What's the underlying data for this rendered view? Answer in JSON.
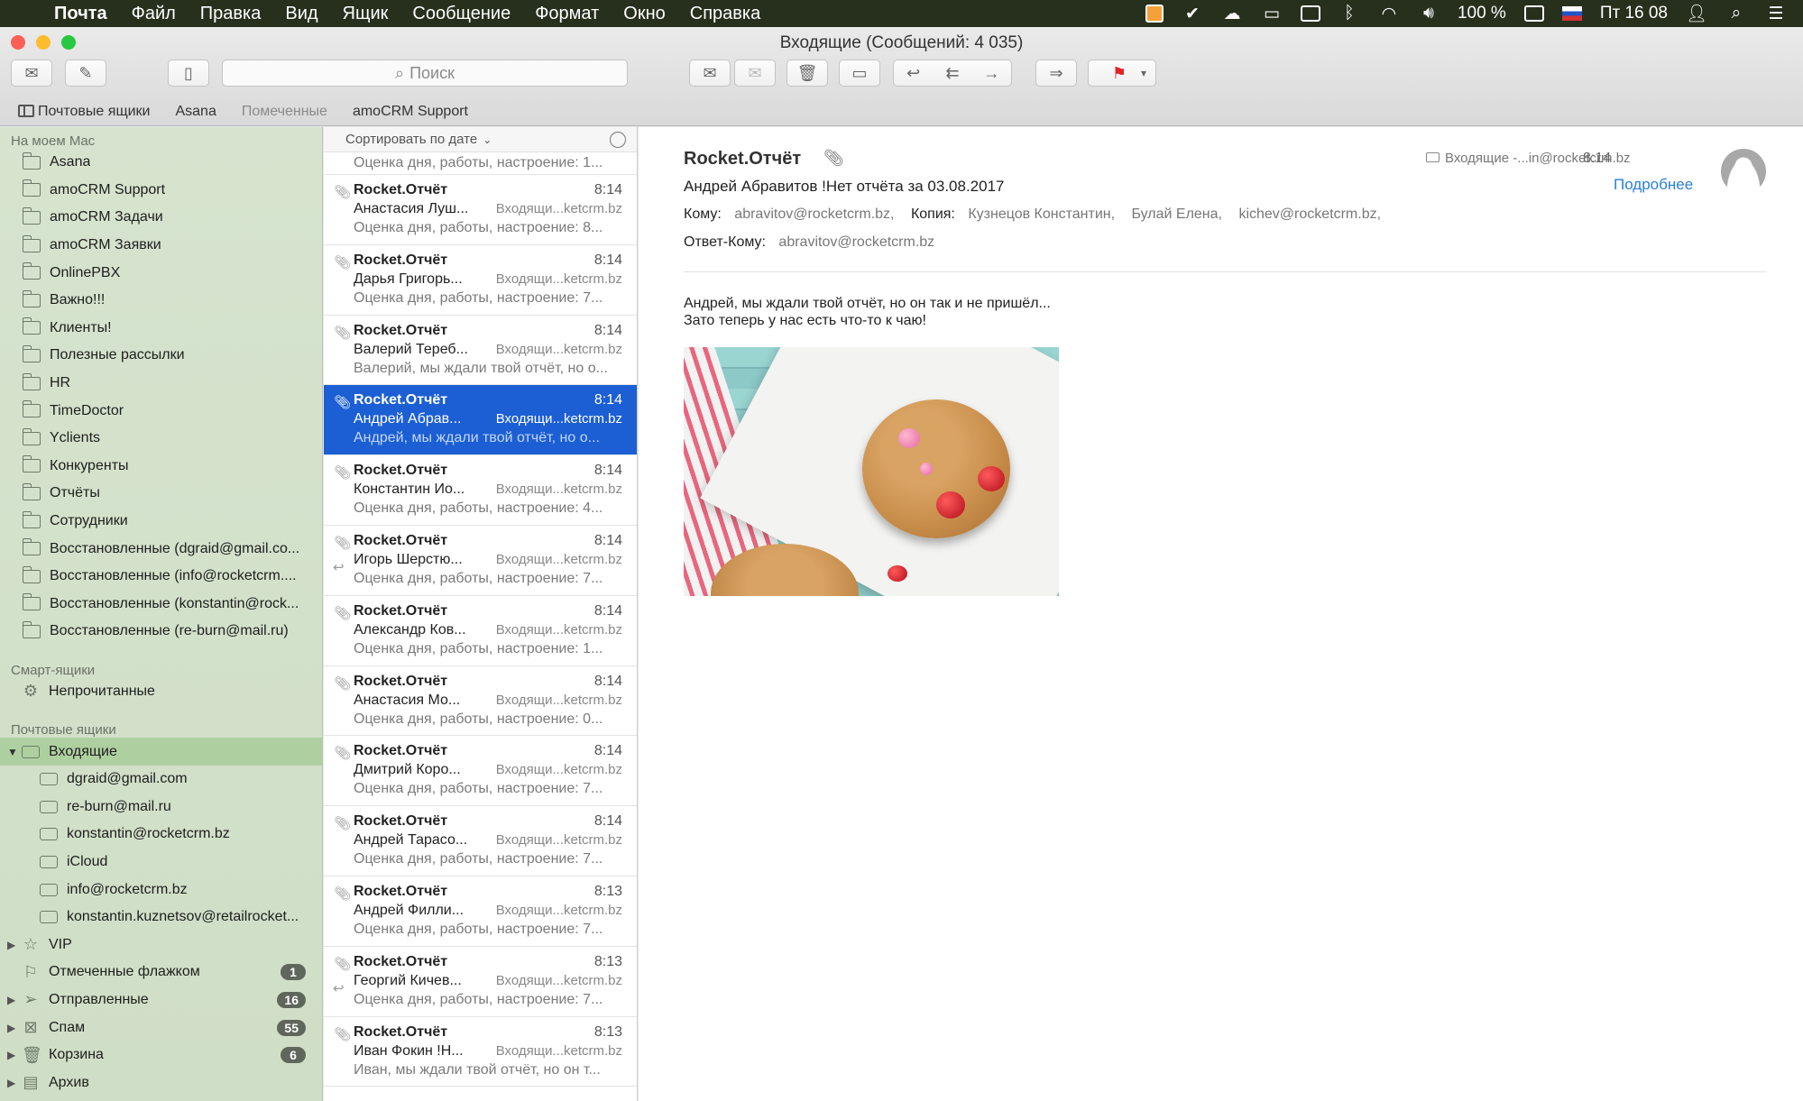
{
  "menubar": {
    "app": "Почта",
    "items": [
      "Файл",
      "Правка",
      "Вид",
      "Ящик",
      "Сообщение",
      "Формат",
      "Окно",
      "Справка"
    ],
    "battery": "100 %",
    "clock": "Пт 16 08"
  },
  "window": {
    "title": "Входящие (Сообщений: 4 035)"
  },
  "toolbar": {
    "search_placeholder": "Поиск"
  },
  "favorites": {
    "mailboxes": "Почтовые ящики",
    "items": [
      "Asana",
      "Помеченные",
      "amoCRM Support"
    ]
  },
  "sidebar": {
    "on_mac_title": "На моем Mac",
    "on_mac": [
      "Asana",
      "amoCRM Support",
      "amoCRM Задачи",
      "amoCRM Заявки",
      "OnlinePBX",
      "Важно!!!",
      "Клиенты!",
      "Полезные рассылки",
      "HR",
      "TimeDoctor",
      "Yclients",
      "Конкуренты",
      "Отчёты",
      "Сотрудники",
      "Восстановленные (dgraid@gmail.co...",
      "Восстановленные (info@rocketcrm....",
      "Восстановленные (konstantin@rock...",
      "Восстановленные (re-burn@mail.ru)"
    ],
    "smart_title": "Смарт-ящики",
    "smart": [
      "Непрочитанные"
    ],
    "mailboxes_title": "Почтовые ящики",
    "inbox": "Входящие",
    "accounts": [
      "dgraid@gmail.com",
      "re-burn@mail.ru",
      "konstantin@rocketcrm.bz",
      "iCloud",
      "info@rocketcrm.bz",
      "konstantin.kuznetsov@retailrocket..."
    ],
    "vip": "VIP",
    "flagged": {
      "label": "Отмеченные флажком",
      "count": "1"
    },
    "sent": {
      "label": "Отправленные",
      "count": "16"
    },
    "spam": {
      "label": "Спам",
      "count": "55"
    },
    "trash": {
      "label": "Корзина",
      "count": "6"
    },
    "archive": "Архив"
  },
  "list": {
    "sort_label": "Сортировать по дате",
    "cut_preview": "Оценка дня, работы, настроение: 1...",
    "messages": [
      {
        "subject": "Rocket.Отчёт",
        "time": "8:14",
        "from": "Анастасия Луш...",
        "box": "Входящи...ketcrm.bz",
        "preview": "Оценка дня, работы, настроение: 8..."
      },
      {
        "subject": "Rocket.Отчёт",
        "time": "8:14",
        "from": "Дарья Григорь...",
        "box": "Входящи...ketcrm.bz",
        "preview": "Оценка дня, работы, настроение: 7..."
      },
      {
        "subject": "Rocket.Отчёт",
        "time": "8:14",
        "from": "Валерий Тереб...",
        "box": "Входящи...ketcrm.bz",
        "preview": "Валерий, мы ждали твой отчёт, но о..."
      },
      {
        "subject": "Rocket.Отчёт",
        "time": "8:14",
        "from": "Андрей Абрав...",
        "box": "Входящи...ketcrm.bz",
        "preview": "Андрей, мы ждали твой отчёт, но о..."
      },
      {
        "subject": "Rocket.Отчёт",
        "time": "8:14",
        "from": "Константин Ио...",
        "box": "Входящи...ketcrm.bz",
        "preview": "Оценка дня, работы, настроение: 4..."
      },
      {
        "subject": "Rocket.Отчёт",
        "time": "8:14",
        "from": "Игорь Шерстю...",
        "box": "Входящи...ketcrm.bz",
        "preview": "Оценка дня, работы, настроение: 7..."
      },
      {
        "subject": "Rocket.Отчёт",
        "time": "8:14",
        "from": "Александр Ков...",
        "box": "Входящи...ketcrm.bz",
        "preview": "Оценка дня, работы, настроение: 1..."
      },
      {
        "subject": "Rocket.Отчёт",
        "time": "8:14",
        "from": "Анастасия Мо...",
        "box": "Входящи...ketcrm.bz",
        "preview": "Оценка дня, работы, настроение: 0..."
      },
      {
        "subject": "Rocket.Отчёт",
        "time": "8:14",
        "from": "Дмитрий Коро...",
        "box": "Входящи...ketcrm.bz",
        "preview": "Оценка дня, работы, настроение: 7..."
      },
      {
        "subject": "Rocket.Отчёт",
        "time": "8:14",
        "from": "Андрей Тарасо...",
        "box": "Входящи...ketcrm.bz",
        "preview": "Оценка дня, работы, настроение: 7..."
      },
      {
        "subject": "Rocket.Отчёт",
        "time": "8:13",
        "from": "Андрей Филли...",
        "box": "Входящи...ketcrm.bz",
        "preview": "Оценка дня, работы, настроение: 7..."
      },
      {
        "subject": "Rocket.Отчёт",
        "time": "8:13",
        "from": "Георгий Кичев...",
        "box": "Входящи...ketcrm.bz",
        "preview": "Оценка дня, работы, настроение: 7..."
      },
      {
        "subject": "Rocket.Отчёт",
        "time": "8:13",
        "from": "Иван Фокин !Н...",
        "box": "Входящи...ketcrm.bz",
        "preview": "Иван, мы ждали твой отчёт, но он т..."
      }
    ]
  },
  "reader": {
    "subject": "Rocket.Отчёт",
    "from": "Андрей Абравитов !Нет отчёта за 03.08.2017",
    "folder": "Входящие -...in@rocketcrm.bz",
    "time": "8:14",
    "more": "Подробнее",
    "to_label": "Кому:",
    "to": "abravitov@rocketcrm.bz,",
    "cc_label": "Копия:",
    "cc": [
      "Кузнецов Константин,",
      "Булай Елена,",
      "kichev@rocketcrm.bz,"
    ],
    "reply_label": "Ответ-Кому:",
    "reply": "abravitov@rocketcrm.bz",
    "body_line1": "Андрей, мы ждали твой отчёт, но он так и не пришёл...",
    "body_line2": "Зато теперь у нас есть что-то к чаю!"
  }
}
